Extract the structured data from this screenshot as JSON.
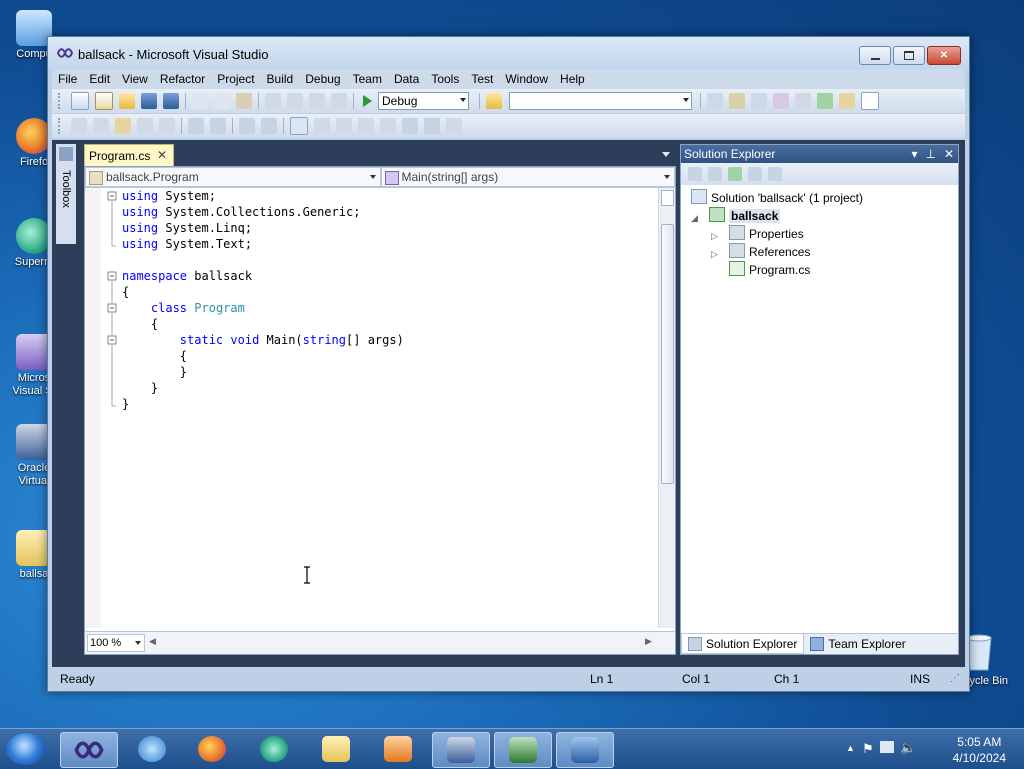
{
  "desktop": {
    "icons": [
      {
        "label": "Compu",
        "color": "#5aa0e0"
      },
      {
        "label": "Firefo",
        "color": "#e8702a"
      },
      {
        "label": "Superm",
        "color": "#2fae8a"
      },
      {
        "label": "Micros Visual St",
        "color": "#7a5fc4"
      },
      {
        "label": "Oracle Virtual",
        "color": "#3a5f9a"
      },
      {
        "label": "ballsa",
        "color": "#e3c45a"
      }
    ],
    "recycle_bin": "Recycle Bin"
  },
  "window": {
    "title": "ballsack - Microsoft Visual Studio",
    "minimize_icon": "minimize-icon",
    "maximize_icon": "maximize-icon",
    "close_label": "✕"
  },
  "menu": [
    "File",
    "Edit",
    "View",
    "Refactor",
    "Project",
    "Build",
    "Debug",
    "Team",
    "Data",
    "Tools",
    "Test",
    "Window",
    "Help"
  ],
  "toolbar": {
    "config": "Debug",
    "search_value": ""
  },
  "toolbox": {
    "label": "Toolbox"
  },
  "editor": {
    "tab": "Program.cs",
    "tab_close": "✕",
    "nav_class": "ballsack.Program",
    "nav_member": "Main(string[] args)",
    "zoom": "100 %",
    "lines": [
      {
        "parts": [
          [
            "kw",
            "using"
          ],
          [
            "txt",
            " System;"
          ]
        ]
      },
      {
        "parts": [
          [
            "kw",
            "using"
          ],
          [
            "txt",
            " System.Collections.Generic;"
          ]
        ]
      },
      {
        "parts": [
          [
            "kw",
            "using"
          ],
          [
            "txt",
            " System.Linq;"
          ]
        ]
      },
      {
        "parts": [
          [
            "kw",
            "using"
          ],
          [
            "txt",
            " System.Text;"
          ]
        ]
      },
      {
        "parts": []
      },
      {
        "parts": [
          [
            "kw",
            "namespace"
          ],
          [
            "txt",
            " ballsack"
          ]
        ]
      },
      {
        "parts": [
          [
            "txt",
            "{"
          ]
        ]
      },
      {
        "parts": [
          [
            "txt",
            "    "
          ],
          [
            "kw",
            "class"
          ],
          [
            "txt",
            " "
          ],
          [
            "ty",
            "Program"
          ]
        ]
      },
      {
        "parts": [
          [
            "txt",
            "    {"
          ]
        ]
      },
      {
        "parts": [
          [
            "txt",
            "        "
          ],
          [
            "kw",
            "static"
          ],
          [
            "txt",
            " "
          ],
          [
            "kw",
            "void"
          ],
          [
            "txt",
            " Main("
          ],
          [
            "kw",
            "string"
          ],
          [
            "txt",
            "[] args)"
          ]
        ]
      },
      {
        "parts": [
          [
            "txt",
            "        {"
          ]
        ]
      },
      {
        "parts": [
          [
            "txt",
            "        }"
          ]
        ]
      },
      {
        "parts": [
          [
            "txt",
            "    }"
          ]
        ]
      },
      {
        "parts": [
          [
            "txt",
            "}"
          ]
        ]
      }
    ]
  },
  "solution_explorer": {
    "title": "Solution Explorer",
    "solution": "Solution 'ballsack' (1 project)",
    "project": "ballsack",
    "items": [
      "Properties",
      "References",
      "Program.cs"
    ],
    "tabs": [
      "Solution Explorer",
      "Team Explorer"
    ]
  },
  "status": {
    "ready": "Ready",
    "ln": "Ln 1",
    "col": "Col 1",
    "ch": "Ch 1",
    "ins": "INS"
  },
  "taskbar": {
    "time": "5:05 AM",
    "date": "4/10/2024"
  }
}
